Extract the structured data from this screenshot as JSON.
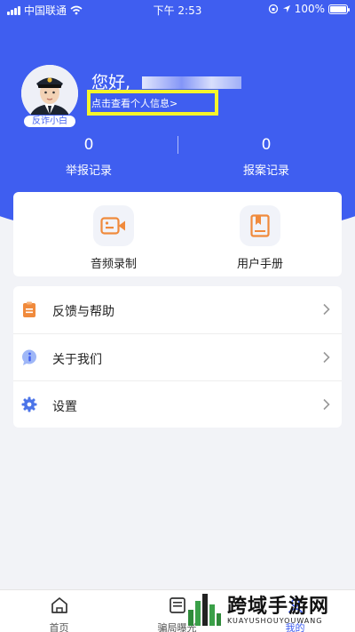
{
  "status_bar": {
    "carrier": "中国联通",
    "time": "下午 2:53",
    "battery": "100%"
  },
  "profile": {
    "avatar_tag": "反诈小白",
    "greeting": "您好,",
    "profile_link": "点击查看个人信息>"
  },
  "stats": [
    {
      "value": "0",
      "label": "举报记录"
    },
    {
      "value": "0",
      "label": "报案记录"
    }
  ],
  "tools": [
    {
      "label": "音频录制",
      "icon": "video-camera-icon"
    },
    {
      "label": "用户手册",
      "icon": "book-icon"
    }
  ],
  "menu": [
    {
      "label": "反馈与帮助",
      "icon": "clipboard-icon"
    },
    {
      "label": "关于我们",
      "icon": "info-icon"
    },
    {
      "label": "设置",
      "icon": "gear-icon"
    }
  ],
  "tabs": [
    {
      "label": "首页",
      "icon": "home-icon"
    },
    {
      "label": "骗局曝光",
      "icon": "exposure-icon"
    },
    {
      "label": "我的",
      "icon": "user-icon"
    }
  ],
  "watermark": {
    "title": "跨域手游网",
    "subtitle": "KUAYUSHOUYOUWANG"
  },
  "colors": {
    "primary": "#3f5ef0",
    "highlight": "#f5f52a",
    "icon_orange": "#f08a3c",
    "icon_blue": "#4b74e8",
    "background": "#f2f3f7"
  }
}
